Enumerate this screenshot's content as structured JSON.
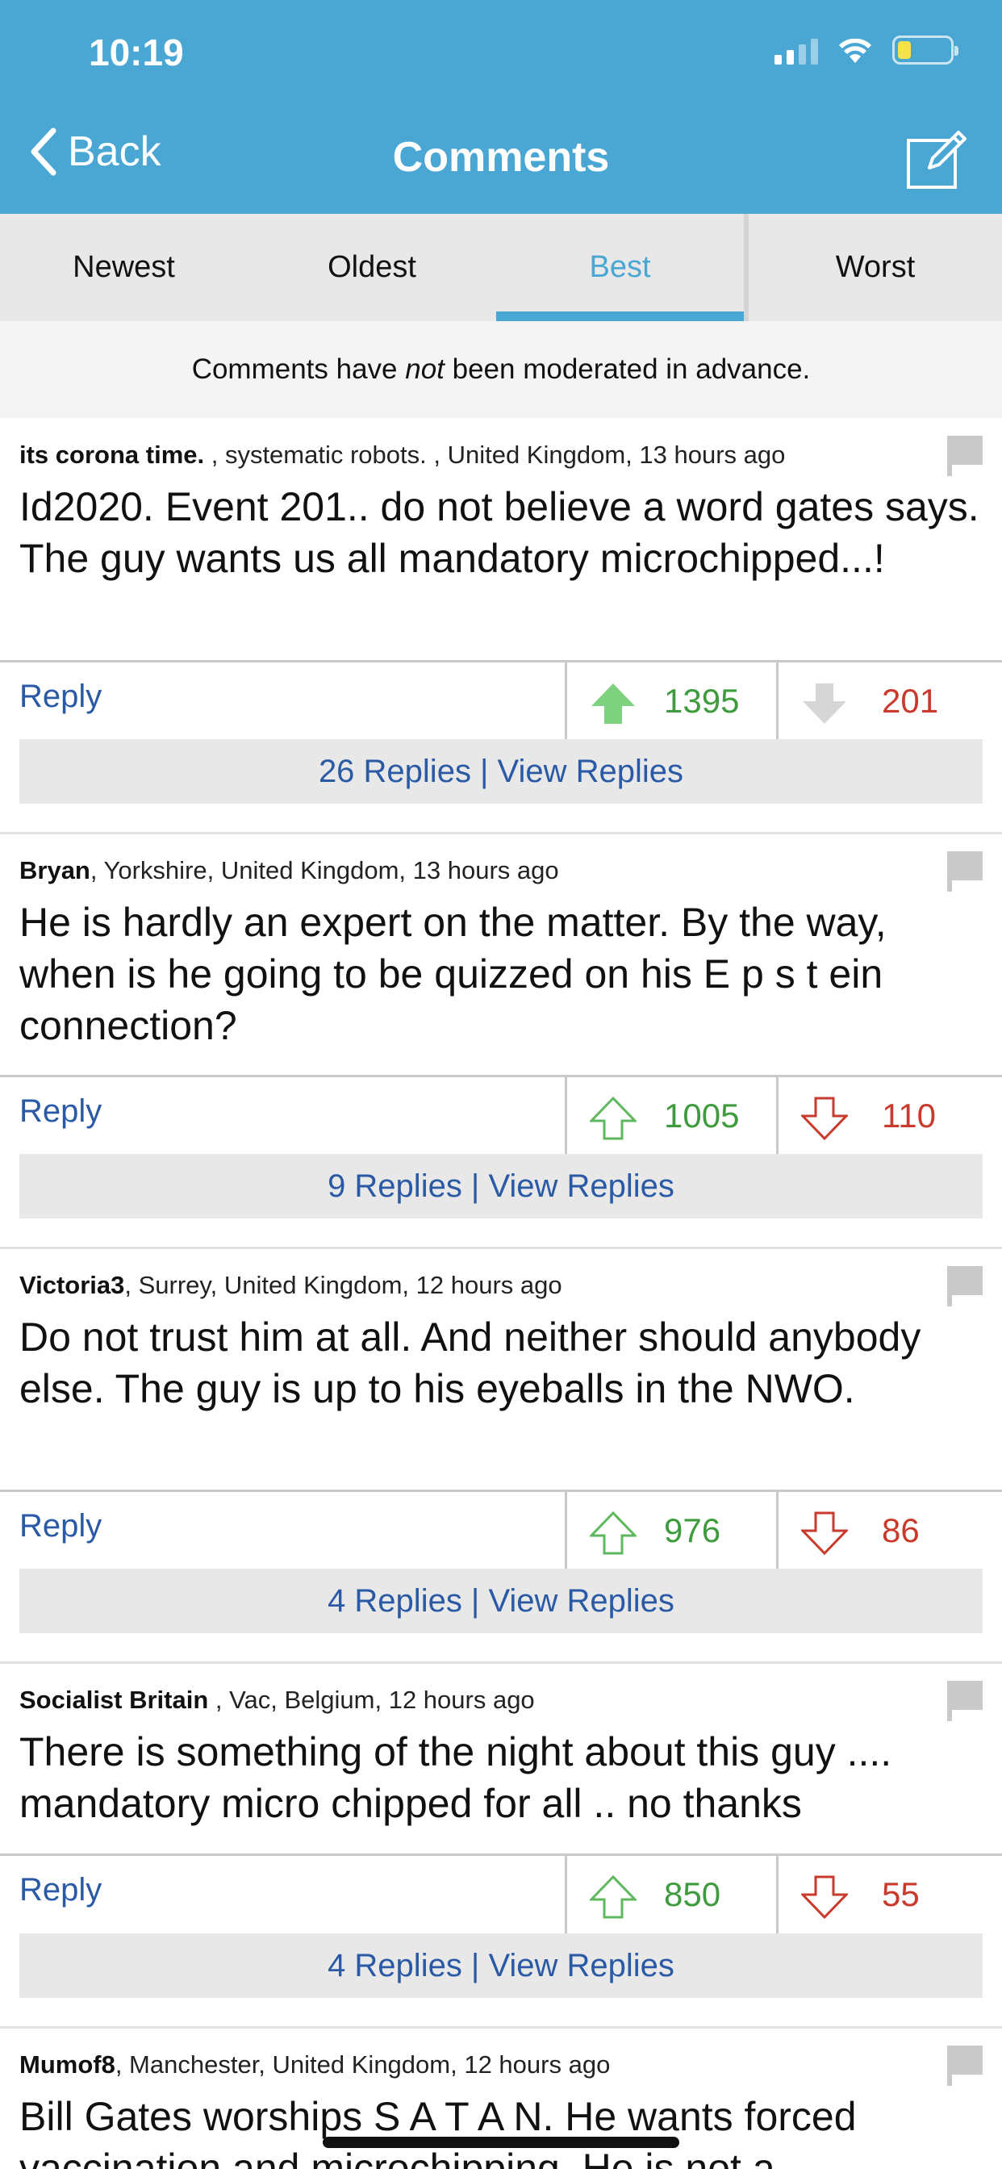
{
  "status": {
    "time": "10:19"
  },
  "header": {
    "back_label": "Back",
    "title": "Comments",
    "compose_icon": "compose-icon"
  },
  "tabs": [
    {
      "label": "Newest"
    },
    {
      "label": "Oldest"
    },
    {
      "label": "Best",
      "active": true
    },
    {
      "label": "Worst"
    }
  ],
  "notice": {
    "before": "Comments have ",
    "emphasis": "not",
    "after": " been moderated in advance."
  },
  "colors": {
    "header": "#4aa7d4",
    "link": "#2a5aa5",
    "upvote": "#3e9b3e",
    "downvote": "#c93a2c",
    "accent": "#4aa7d4"
  },
  "comments": [
    {
      "author": "its corona time.",
      "meta": " , systematic robots. , United Kingdom, 13 hours ago",
      "text": "Id2020. Event 201.. do not believe a word gates says. The guy wants us all mandatory microchipped...!",
      "reply_label": "Reply",
      "upvotes": "1395",
      "downvotes": "201",
      "replies_label": "26 Replies | View Replies"
    },
    {
      "author": "Bryan",
      "meta": ", Yorkshire, United Kingdom, 13 hours ago",
      "text": "He is hardly an expert on the matter. By the way, when is he going to be quizzed on his E p s t ein connection?",
      "reply_label": "Reply",
      "upvotes": "1005",
      "downvotes": "110",
      "replies_label": "9 Replies | View Replies"
    },
    {
      "author": "Victoria3",
      "meta": ", Surrey, United Kingdom, 12 hours ago",
      "text": "Do not trust him at all. And neither should anybody else. The guy is up to his eyeballs in the NWO.",
      "reply_label": "Reply",
      "upvotes": "976",
      "downvotes": "86",
      "replies_label": "4 Replies | View Replies"
    },
    {
      "author": "Socialist Britain",
      "meta": " , Vac, Belgium, 12 hours ago",
      "text": "There is something of the night about this guy .... mandatory micro chipped for all .. no thanks",
      "reply_label": "Reply",
      "upvotes": "850",
      "downvotes": "55",
      "replies_label": "4 Replies | View Replies"
    },
    {
      "author": "Mumof8",
      "meta": ", Manchester, United Kingdom, 12 hours ago",
      "text": "Bill Gates worships S A T A N. He wants forced vaccination and microchipping. He is not a"
    }
  ]
}
